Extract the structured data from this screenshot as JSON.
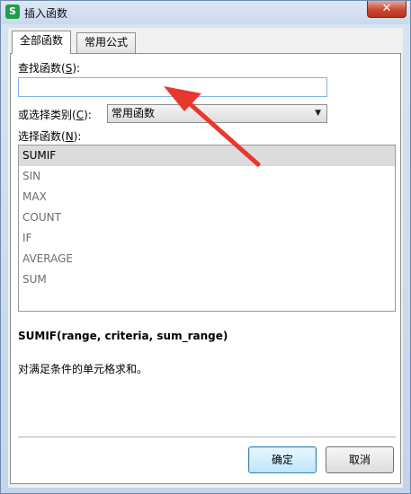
{
  "window": {
    "title": "插入函数",
    "app_icon_letter": "S",
    "close_glyph": "✕"
  },
  "tabs": [
    {
      "label": "全部函数",
      "active": true
    },
    {
      "label": "常用公式",
      "active": false
    }
  ],
  "search": {
    "label_text": "查找函数(",
    "label_key": "S",
    "label_tail": "):",
    "value": "",
    "placeholder": ""
  },
  "category": {
    "label_text": "或选择类别(",
    "label_key": "C",
    "label_tail": "):",
    "selected": "常用函数"
  },
  "functions": {
    "label_text": "选择函数(",
    "label_key": "N",
    "label_tail": "):",
    "items": [
      "SUMIF",
      "SIN",
      "MAX",
      "COUNT",
      "IF",
      "AVERAGE",
      "SUM"
    ],
    "selected": "SUMIF"
  },
  "details": {
    "signature": "SUMIF(range, criteria, sum_range)",
    "description": "对满足条件的单元格求和。"
  },
  "buttons": {
    "ok_label": "确定",
    "cancel_label": "取消"
  },
  "annotation": {
    "arrow_color": "#e8372c"
  }
}
